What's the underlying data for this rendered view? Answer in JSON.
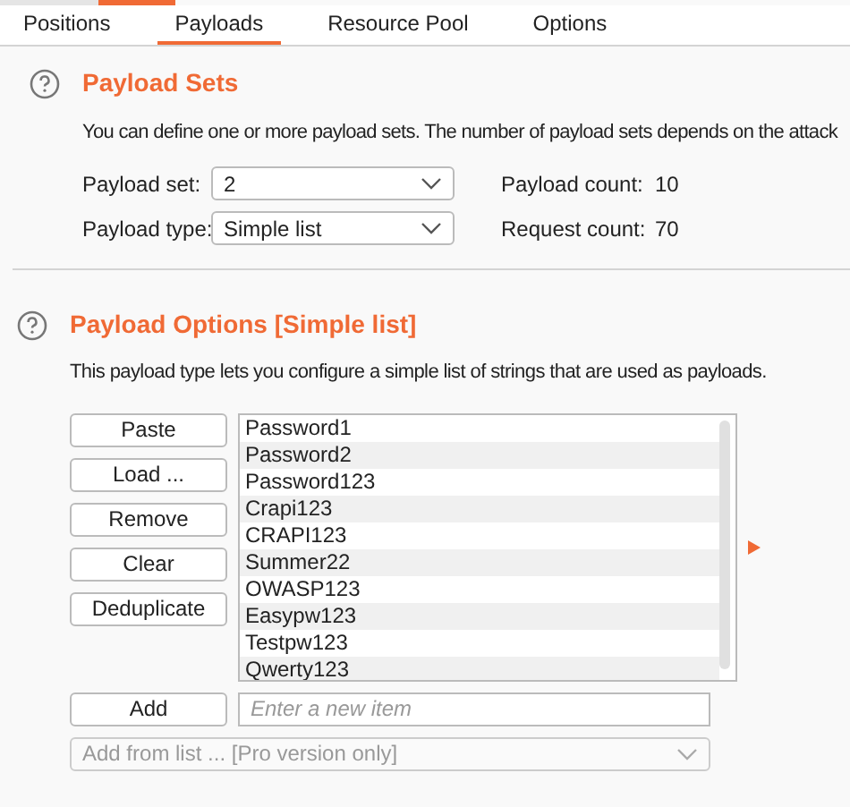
{
  "tabs": [
    {
      "label": "Positions",
      "selected": false
    },
    {
      "label": "Payloads",
      "selected": true
    },
    {
      "label": "Resource Pool",
      "selected": false
    },
    {
      "label": "Options",
      "selected": false
    }
  ],
  "payload_sets": {
    "title": "Payload Sets",
    "description": "You can define one or more payload sets. The number of payload sets depends on the attack",
    "fields": [
      {
        "label": "Payload set:",
        "value": "2",
        "stat_label": "Payload count:",
        "stat_value": "10"
      },
      {
        "label": "Payload type:",
        "value": "Simple list",
        "stat_label": "Request count:",
        "stat_value": "70"
      }
    ]
  },
  "payload_options": {
    "title": "Payload Options [Simple list]",
    "description": "This payload type lets you configure a simple list of strings that are used as payloads.",
    "buttons": [
      "Paste",
      "Load ...",
      "Remove",
      "Clear",
      "Deduplicate"
    ],
    "items": [
      "Password1",
      "Password2",
      "Password123",
      "Crapi123",
      "CRAPI123",
      "Summer22",
      "OWASP123",
      "Easypw123",
      "Testpw123",
      "Qwerty123"
    ],
    "add_button": "Add",
    "new_item": {
      "placeholder": "Enter a new item"
    },
    "add_from_list": {
      "value": "Add from list ... [Pro version only]",
      "disabled": true
    }
  }
}
